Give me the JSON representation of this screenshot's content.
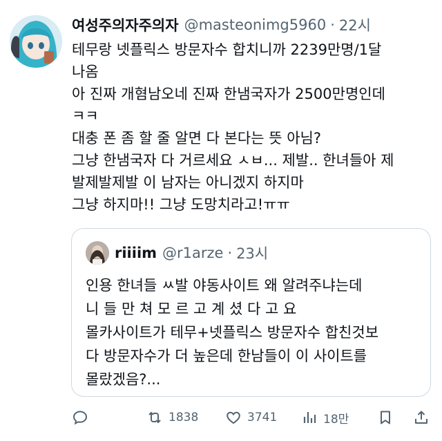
{
  "author": {
    "name": "여성주의자주의자",
    "handle": "@masteonimg5960",
    "separator": "·",
    "time": "22시"
  },
  "tweet_lines": [
    "테무랑 넷플릭스 방문자수 합치니까 2239만명/1달",
    "나옴",
    "아 진짜 개혐남오네 진짜 한냄국자가 2500만명인데",
    "ㅋㅋ",
    "대충 폰 좀 할 줄 알면 다 본다는 뜻 아님?",
    "그냥 한냄국자 다 거르세요 ㅅㅂ... 제발.. 한녀들아 제",
    "발제발제발 이 남자는 아니겠지 하지마",
    "그냥 하지마!! 그냥 도망치라고!ㅠㅠ"
  ],
  "quoted": {
    "name": "riiiim",
    "handle": "@r1arze",
    "separator": "·",
    "time": "23시",
    "lines": [
      "인용 한녀들 ㅆ발 야동사이트 왜 알려주냐는데",
      "니 들 만 쳐 모 르 고 계 셨 다 고 요",
      "몰카사이트가 테무+넷플릭스 방문자수 합친것보",
      "다 방문자수가 더 높은데 한남들이 이 사이트를",
      "몰랐겠음?..."
    ]
  },
  "actions": {
    "reply": {
      "icon": "reply-icon"
    },
    "retweet": {
      "icon": "retweet-icon",
      "count": "1838"
    },
    "like": {
      "icon": "heart-icon",
      "count": "3741"
    },
    "views": {
      "icon": "views-icon",
      "count": "18만"
    },
    "bookmark": {
      "icon": "bookmark-icon"
    },
    "share": {
      "icon": "share-icon"
    }
  },
  "colors": {
    "text": "#0f1419",
    "secondary": "#536471",
    "border": "#cfd9de"
  }
}
